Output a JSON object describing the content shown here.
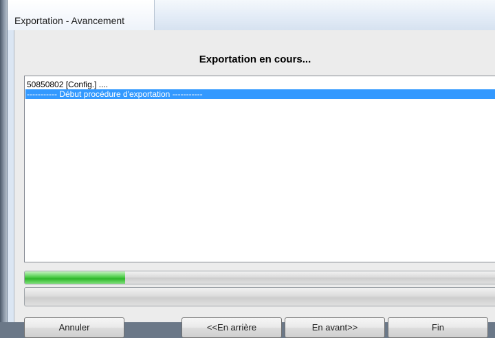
{
  "window": {
    "title": "Exportation - Avancement"
  },
  "main": {
    "heading": "Exportation en cours...",
    "log_lines": [
      "50850802 [Config.] ....",
      "----------- Début procédure d'exportation -----------"
    ],
    "selected_index": 1
  },
  "progress": {
    "primary_fraction": 0.21,
    "secondary_fraction": 0.0,
    "fill_color": "#3dc238"
  },
  "buttons": {
    "cancel": "Annuler",
    "back": "<<En arrière",
    "next": "En avant>>",
    "finish": "Fin"
  }
}
